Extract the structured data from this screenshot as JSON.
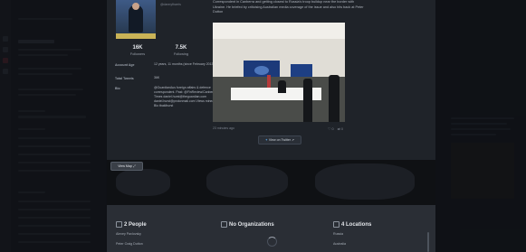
{
  "profile": {
    "handle": "@dannyfharris",
    "followers_value": "16K",
    "followers_label": "Followers",
    "following_value": "7.5K",
    "following_label": "Following",
    "account_age_label": "Account Age",
    "account_age_value": "12 years, 11 months (since February 2013)",
    "total_tweets_label": "Total Tweets",
    "total_tweets_value": "36K",
    "bio_label": "Bio",
    "bio_value": "@GuardianAus foreign affairs & defence correspondent. Past: @FinReview/Canberra Times daniel.hurst@theguardian.com daniel.hurst@protonmail.com Views mine/tks no Bio tbaklhurst"
  },
  "tweet": {
    "text": "Correspondent in Canberra and getting closest to Russia's troop buildup near the border with Ukraine. He briefed by criticising Australian media coverage of the issue and also hits back at Peter Dutton",
    "time": "23 minutes ago",
    "likes": "0",
    "retweets": "0",
    "view_twitter_label": "View on Twitter"
  },
  "map": {
    "view_map_label": "View Map"
  },
  "entities": {
    "people_heading": "2 People",
    "people": [
      "Alexey Pavlovsky",
      "Peter Craig Dutton"
    ],
    "orgs_heading": "No Organizations",
    "locations_heading": "4 Locations",
    "locations": [
      "Russia",
      "Australia"
    ]
  }
}
